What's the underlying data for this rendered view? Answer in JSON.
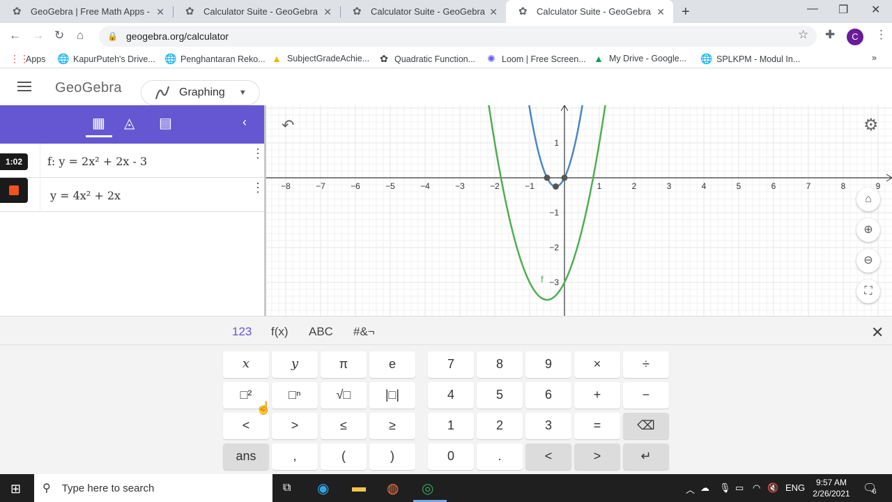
{
  "browser": {
    "tabs": [
      {
        "title": "GeoGebra | Free Math Apps - use",
        "active": false
      },
      {
        "title": "Calculator Suite - GeoGebra",
        "active": false
      },
      {
        "title": "Calculator Suite - GeoGebra",
        "active": false
      },
      {
        "title": "Calculator Suite - GeoGebra",
        "active": true
      }
    ],
    "url": "geogebra.org/calculator",
    "profile_initial": "C",
    "bookmarks": [
      {
        "label": "Apps",
        "icon": "apps-grid-icon"
      },
      {
        "label": "KapurPuteh's Drive...",
        "icon": "globe-icon"
      },
      {
        "label": "Penghantaran Reko...",
        "icon": "globe-icon"
      },
      {
        "label": "SubjectGradeAchie...",
        "icon": "drive-icon"
      },
      {
        "label": "Quadratic Function...",
        "icon": "geogebra-icon"
      },
      {
        "label": "Loom | Free Screen...",
        "icon": "loom-icon"
      },
      {
        "label": "My Drive - Google...",
        "icon": "drive-icon"
      },
      {
        "label": "SPLKPM - Modul In...",
        "icon": "globe-icon"
      }
    ]
  },
  "app": {
    "logo": "GeoGebra",
    "app_name": "Graphing"
  },
  "algebra": {
    "rows": [
      {
        "marble_text": "1:02",
        "formula": "f: y = 2x² + 2x - 3"
      },
      {
        "marble_text": "",
        "formula": "y = 4x² + 2x"
      }
    ]
  },
  "graph": {
    "x_ticks": [
      "−8",
      "−7",
      "−6",
      "−5",
      "−4",
      "−3",
      "−2",
      "−1",
      "1",
      "2",
      "3",
      "4",
      "5",
      "6",
      "7",
      "8",
      "9"
    ],
    "y_ticks": [
      "1",
      "−1",
      "−2",
      "−3"
    ],
    "function_label": "f",
    "colors": {
      "f": "#4caf50",
      "g": "#4a86c6",
      "grid": "#e6e6e6",
      "axis": "#333333"
    }
  },
  "keyboard": {
    "tabs": [
      "123",
      "f(x)",
      "ABC",
      "#&¬"
    ],
    "active_tab": "123",
    "left_keys": [
      [
        "x",
        "y",
        "π",
        "e"
      ],
      [
        "□²",
        "□ⁿ",
        "√□",
        "|□|"
      ],
      [
        "<",
        ">",
        "≤",
        "≥"
      ],
      [
        "ans",
        ",",
        "(",
        ")"
      ]
    ],
    "right_keys": [
      [
        "7",
        "8",
        "9",
        "×",
        "÷"
      ],
      [
        "4",
        "5",
        "6",
        "+",
        "−"
      ],
      [
        "1",
        "2",
        "3",
        "=",
        "⌫"
      ],
      [
        "0",
        ".",
        "<",
        ">",
        "↵"
      ]
    ]
  },
  "taskbar": {
    "search_placeholder": "Type here to search",
    "language": "ENG",
    "time": "9:57 AM",
    "date": "2/26/2021",
    "notification_count": "6"
  }
}
